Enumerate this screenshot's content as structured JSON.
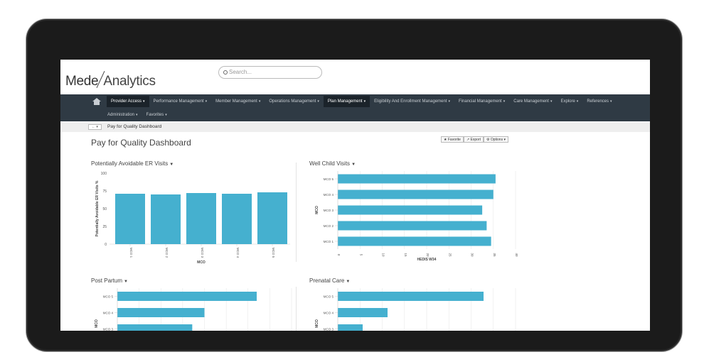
{
  "app": {
    "logo_left": "Mede",
    "logo_right": "Analytics",
    "search_placeholder": "Search..."
  },
  "nav": {
    "row1": [
      {
        "label": "Provider Access",
        "active": true
      },
      {
        "label": "Performance Management",
        "active": false
      },
      {
        "label": "Member Management",
        "active": false
      },
      {
        "label": "Operations Management",
        "active": false
      },
      {
        "label": "Plan Management",
        "active": true
      },
      {
        "label": "Eligibility And Enrollment Management",
        "active": false
      },
      {
        "label": "Financial Management",
        "active": false
      },
      {
        "label": "Care Management",
        "active": false
      },
      {
        "label": "Explore",
        "active": false
      },
      {
        "label": "References",
        "active": false
      }
    ],
    "row2": [
      {
        "label": "Administration",
        "active": false
      },
      {
        "label": "Favorites",
        "active": false
      }
    ]
  },
  "breadcrumb": {
    "back_label": "← ▾",
    "current": "Pay for Quality Dashboard"
  },
  "page": {
    "title": "Pay for Quality Dashboard",
    "favorite_label": "★ Favorite",
    "export_label": "↗ Export",
    "options_label": "⚙ Options ▾"
  },
  "chart_data": [
    {
      "type": "bar",
      "title": "Potentially Avoidable ER Visits",
      "categories": [
        "MCO 1",
        "MCO 2",
        "MCO 3",
        "MCO 4",
        "MCO 5"
      ],
      "values": [
        71,
        70,
        72,
        71,
        73
      ],
      "xlabel": "MCO",
      "ylabel": "Potentially Avoidable ER Visits %",
      "ylim": [
        0,
        100
      ],
      "yticks": [
        0,
        25,
        50,
        75,
        100
      ],
      "color": "#45b0cf"
    },
    {
      "type": "bar",
      "orientation": "horizontal",
      "title": "Well Child Visits",
      "categories": [
        "MCO 5",
        "MCO 4",
        "MCO 3",
        "MCO 2",
        "MCO 1"
      ],
      "values": [
        71,
        70,
        65,
        67,
        69
      ],
      "xlabel": "HEDIS W34",
      "ylabel": "MCO",
      "xlim": [
        0,
        80
      ],
      "xticks": [
        0,
        10,
        20,
        30,
        40,
        50,
        60,
        70,
        80
      ],
      "xtick_labels": [
        "0",
        "5",
        "10",
        "15",
        "20",
        "25",
        "30",
        "35",
        "40"
      ],
      "color": "#45b0cf"
    },
    {
      "type": "bar",
      "orientation": "horizontal",
      "title": "Post Partum",
      "categories": [
        "MCO 5",
        "MCO 4",
        "MCO 3"
      ],
      "values": [
        80,
        50,
        43
      ],
      "xlim": [
        0,
        100
      ],
      "ylabel": "MCO",
      "color": "#45b0cf"
    },
    {
      "type": "bar",
      "orientation": "horizontal",
      "title": "Prenatal Care",
      "categories": [
        "MCO 5",
        "MCO 4",
        "MCO 3"
      ],
      "values": [
        82,
        28,
        14
      ],
      "xlim": [
        0,
        100
      ],
      "ylabel": "MCO",
      "color": "#45b0cf"
    }
  ]
}
